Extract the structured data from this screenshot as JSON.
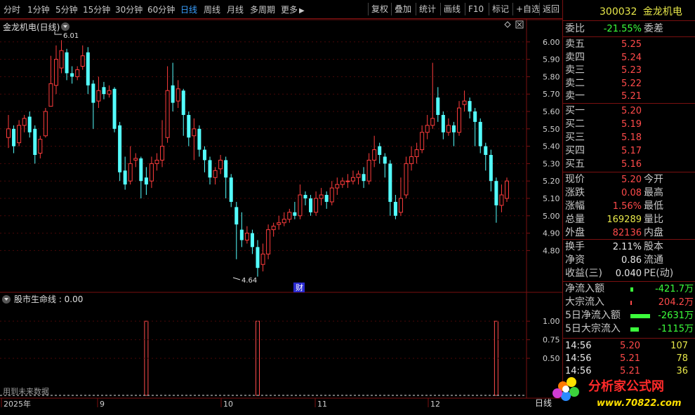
{
  "toolbar": {
    "periods": [
      "分时",
      "1分钟",
      "5分钟",
      "15分钟",
      "30分钟",
      "60分钟",
      "日线",
      "周线",
      "月线",
      "多周期",
      "更多"
    ],
    "active_period": "日线",
    "right_buttons": [
      "复权",
      "叠加",
      "统计",
      "画线",
      "F10",
      "标记",
      "+自选",
      "返回"
    ]
  },
  "stock": {
    "code": "300032",
    "name": "金龙机电",
    "chart_title": "金龙机电(日线)",
    "high_label": "6.01",
    "low_label": "4.64",
    "fin_marker": "财"
  },
  "indicator": {
    "title": "股市生命线 : 0.00",
    "footer_note": "用到未来数据"
  },
  "order_book": {
    "weibi_label": "委比",
    "weibi_value": "-21.55%",
    "weicha_label": "委差",
    "sells": [
      {
        "label": "卖五",
        "price": "5.25"
      },
      {
        "label": "卖四",
        "price": "5.24"
      },
      {
        "label": "卖三",
        "price": "5.23"
      },
      {
        "label": "卖二",
        "price": "5.22"
      },
      {
        "label": "卖一",
        "price": "5.21"
      }
    ],
    "buys": [
      {
        "label": "买一",
        "price": "5.20"
      },
      {
        "label": "买二",
        "price": "5.19"
      },
      {
        "label": "买三",
        "price": "5.18"
      },
      {
        "label": "买四",
        "price": "5.17"
      },
      {
        "label": "买五",
        "price": "5.16"
      }
    ]
  },
  "quote": [
    {
      "label": "现价",
      "value": "5.20",
      "color": "#ff4a4a",
      "label2": "今开"
    },
    {
      "label": "涨跌",
      "value": "0.08",
      "color": "#ff4a4a",
      "label2": "最高"
    },
    {
      "label": "涨幅",
      "value": "1.56%",
      "color": "#ff4a4a",
      "label2": "最低"
    },
    {
      "label": "总量",
      "value": "169289",
      "color": "#e8e84a",
      "label2": "量比"
    },
    {
      "label": "外盘",
      "value": "82136",
      "color": "#ff4a4a",
      "label2": "内盘"
    }
  ],
  "fundamentals": [
    {
      "label": "换手",
      "value": "2.11%",
      "label2": "股本"
    },
    {
      "label": "净资",
      "value": "0.86",
      "label2": "流通"
    },
    {
      "label": "收益(三)",
      "value": "0.040",
      "label2": "PE(动)"
    }
  ],
  "flows": [
    {
      "label": "净流入额",
      "value": "-421.7万",
      "color": "#3cff3c",
      "bar": "green",
      "bar_pct": 0.16
    },
    {
      "label": "大宗流入",
      "value": "204.2万",
      "color": "#ff4a4a",
      "bar": "red",
      "bar_pct": 0.08
    },
    {
      "label": "5日净流入额",
      "value": "-2631万",
      "color": "#3cff3c",
      "bar": "green",
      "bar_pct": 1.0
    },
    {
      "label": "5日大宗流入",
      "value": "-1115万",
      "color": "#3cff3c",
      "bar": "green",
      "bar_pct": 0.42
    }
  ],
  "ticks": [
    {
      "time": "14:56",
      "price": "5.20",
      "volume": "107"
    },
    {
      "time": "14:56",
      "price": "5.21",
      "volume": "78"
    },
    {
      "time": "14:56",
      "price": "5.21",
      "volume": "36"
    }
  ],
  "axis": {
    "price_ticks": [
      "6.00",
      "5.90",
      "5.80",
      "5.70",
      "5.60",
      "5.50",
      "5.40",
      "5.30",
      "5.20",
      "5.10",
      "5.00",
      "4.90",
      "4.80"
    ],
    "ind_ticks": [
      "1.00",
      "0.75",
      "0.50"
    ],
    "date_labels": [
      "2025年",
      "9",
      "10",
      "11",
      "12"
    ],
    "corner_label": "日线"
  },
  "watermark": {
    "brand": "分析家公式网",
    "url": "www.70822.com"
  },
  "colors": {
    "up": "#ff3c3c",
    "down": "#54ffff",
    "grid": "#7a1010",
    "accent": "#3aa0ff"
  },
  "chart_data": {
    "type": "candlestick",
    "ylim": [
      4.6,
      6.1
    ],
    "candles": [
      [
        5.45,
        5.5,
        5.58,
        5.39
      ],
      [
        5.5,
        5.4,
        5.52,
        5.36
      ],
      [
        5.42,
        5.52,
        5.55,
        5.4
      ],
      [
        5.52,
        5.56,
        5.58,
        5.48
      ],
      [
        5.57,
        5.48,
        5.6,
        5.45
      ],
      [
        5.5,
        5.35,
        5.52,
        5.3
      ],
      [
        5.36,
        5.44,
        5.46,
        5.33
      ],
      [
        5.46,
        5.6,
        5.62,
        5.45
      ],
      [
        5.63,
        5.76,
        5.92,
        5.68
      ],
      [
        5.75,
        5.9,
        5.98,
        5.7
      ],
      [
        5.85,
        5.95,
        6.01,
        5.82
      ],
      [
        5.94,
        5.82,
        5.96,
        5.78
      ],
      [
        5.82,
        5.8,
        5.86,
        5.76
      ],
      [
        5.8,
        5.84,
        5.86,
        5.78
      ],
      [
        5.86,
        5.92,
        5.98,
        5.84
      ],
      [
        5.94,
        5.75,
        5.97,
        5.7
      ],
      [
        5.76,
        5.65,
        5.78,
        5.5
      ],
      [
        5.66,
        5.72,
        5.8,
        5.62
      ],
      [
        5.74,
        5.7,
        5.77,
        5.67
      ],
      [
        5.7,
        5.72,
        5.75,
        5.68
      ],
      [
        5.73,
        5.5,
        5.74,
        5.48
      ],
      [
        5.52,
        5.25,
        5.54,
        5.2
      ],
      [
        5.26,
        5.18,
        5.34,
        5.15
      ],
      [
        5.2,
        5.3,
        5.4,
        5.18
      ],
      [
        5.32,
        5.33,
        5.36,
        5.28
      ],
      [
        5.33,
        5.2,
        5.34,
        5.1
      ],
      [
        5.22,
        5.18,
        5.28,
        5.12
      ],
      [
        5.2,
        5.3,
        5.34,
        5.16
      ],
      [
        5.3,
        5.32,
        5.36,
        5.26
      ],
      [
        5.32,
        5.4,
        5.55,
        5.28
      ],
      [
        5.45,
        5.72,
        5.86,
        5.42
      ],
      [
        5.75,
        5.65,
        5.88,
        5.6
      ],
      [
        5.66,
        5.73,
        5.78,
        5.62
      ],
      [
        5.72,
        5.58,
        5.73,
        5.46
      ],
      [
        5.58,
        5.45,
        5.6,
        5.4
      ],
      [
        5.46,
        5.5,
        5.56,
        5.32
      ],
      [
        5.5,
        5.38,
        5.52,
        5.34
      ],
      [
        5.38,
        5.32,
        5.4,
        5.25
      ],
      [
        5.32,
        5.22,
        5.34,
        5.18
      ],
      [
        5.22,
        5.26,
        5.28,
        5.18
      ],
      [
        5.27,
        5.32,
        5.35,
        5.24
      ],
      [
        5.32,
        5.22,
        5.34,
        5.1
      ],
      [
        5.22,
        5.08,
        5.24,
        5.05
      ],
      [
        5.05,
        4.95,
        5.08,
        4.75
      ],
      [
        4.92,
        4.86,
        5.02,
        4.82
      ],
      [
        4.86,
        4.9,
        4.94,
        4.84
      ],
      [
        4.9,
        4.82,
        4.92,
        4.78
      ],
      [
        4.82,
        4.7,
        4.86,
        4.65
      ],
      [
        4.72,
        4.78,
        4.84,
        4.68
      ],
      [
        4.78,
        4.92,
        4.95,
        4.75
      ],
      [
        4.92,
        4.94,
        4.96,
        4.88
      ],
      [
        4.95,
        4.96,
        5.0,
        4.92
      ],
      [
        4.96,
        4.98,
        5.02,
        4.94
      ],
      [
        4.98,
        5.02,
        5.04,
        4.96
      ],
      [
        5.02,
        5.0,
        5.08,
        4.98
      ],
      [
        5.0,
        5.12,
        5.18,
        4.98
      ],
      [
        5.12,
        5.1,
        5.14,
        5.06
      ],
      [
        5.1,
        5.02,
        5.12,
        5.0
      ],
      [
        5.02,
        5.1,
        5.14,
        5.0
      ],
      [
        5.1,
        5.12,
        5.16,
        5.06
      ],
      [
        5.12,
        5.08,
        5.14,
        5.04
      ],
      [
        5.08,
        5.16,
        5.2,
        5.06
      ],
      [
        5.16,
        5.18,
        5.22,
        5.12
      ],
      [
        5.18,
        5.2,
        5.22,
        5.16
      ],
      [
        5.2,
        5.2,
        5.24,
        5.16
      ],
      [
        5.2,
        5.22,
        5.26,
        5.18
      ],
      [
        5.22,
        5.24,
        5.26,
        5.18
      ],
      [
        5.24,
        5.2,
        5.28,
        5.16
      ],
      [
        5.2,
        5.32,
        5.36,
        5.18
      ],
      [
        5.32,
        5.38,
        5.46,
        5.28
      ],
      [
        5.4,
        5.35,
        5.42,
        5.3
      ],
      [
        5.34,
        5.3,
        5.36,
        5.22
      ],
      [
        5.3,
        5.08,
        5.32,
        5.0
      ],
      [
        5.08,
        5.0,
        5.12,
        4.98
      ],
      [
        5.02,
        5.1,
        5.22,
        5.0
      ],
      [
        5.12,
        5.3,
        5.34,
        5.1
      ],
      [
        5.3,
        5.34,
        5.4,
        5.26
      ],
      [
        5.34,
        5.38,
        5.42,
        5.3
      ],
      [
        5.38,
        5.48,
        5.52,
        5.36
      ],
      [
        5.48,
        5.52,
        5.58,
        5.44
      ],
      [
        5.52,
        5.56,
        5.88,
        5.5
      ],
      [
        5.68,
        5.58,
        5.74,
        5.54
      ],
      [
        5.58,
        5.48,
        5.6,
        5.44
      ],
      [
        5.48,
        5.52,
        5.56,
        5.46
      ],
      [
        5.52,
        5.48,
        5.54,
        5.4
      ],
      [
        5.48,
        5.62,
        5.66,
        5.46
      ],
      [
        5.64,
        5.66,
        5.72,
        5.6
      ],
      [
        5.66,
        5.6,
        5.68,
        5.56
      ],
      [
        5.6,
        5.54,
        5.62,
        5.4
      ],
      [
        5.54,
        5.4,
        5.56,
        5.36
      ],
      [
        5.4,
        5.35,
        5.42,
        5.26
      ],
      [
        5.35,
        5.2,
        5.38,
        5.14
      ],
      [
        5.2,
        5.06,
        5.22,
        4.96
      ],
      [
        5.06,
        5.12,
        5.18,
        5.02
      ],
      [
        5.1,
        5.2,
        5.22,
        5.08
      ]
    ],
    "indicator_spikes": [
      0.0,
      0.0,
      0.0,
      0.0,
      0.0,
      0.0,
      0.0,
      0.0,
      0.0,
      0.0,
      0.0,
      0.0,
      0.0,
      0.0,
      0.0,
      0.0,
      0.0,
      0.0,
      0.0,
      0.0,
      0.0,
      0.0,
      0.0,
      0.0,
      0.0,
      0.0,
      1.0,
      0.0,
      0.0,
      0.0,
      0.0,
      0.0,
      0.0,
      0.0,
      0.0,
      0.0,
      0.0,
      0.0,
      0.0,
      0.0,
      0.0,
      0.0,
      0.0,
      0.0,
      0.0,
      0.0,
      0.0,
      1.0,
      0.0,
      0.0,
      0.0,
      0.0,
      0.0,
      0.0,
      0.0,
      0.0,
      0.0,
      0.0,
      0.0,
      0.0,
      0.0,
      0.0,
      0.0,
      0.0,
      0.0,
      0.0,
      0.0,
      0.0,
      0.0,
      0.0,
      0.0,
      0.0,
      0.0,
      0.0,
      0.0,
      0.0,
      0.0,
      0.0,
      0.0,
      0.0,
      0.0,
      0.0,
      0.0,
      0.0,
      0.0,
      0.0,
      0.0,
      0.0,
      0.0,
      0.0,
      0.0,
      0.0,
      1.0,
      0.0,
      0.0
    ],
    "ind_ylim": [
      0,
      1.2
    ]
  }
}
